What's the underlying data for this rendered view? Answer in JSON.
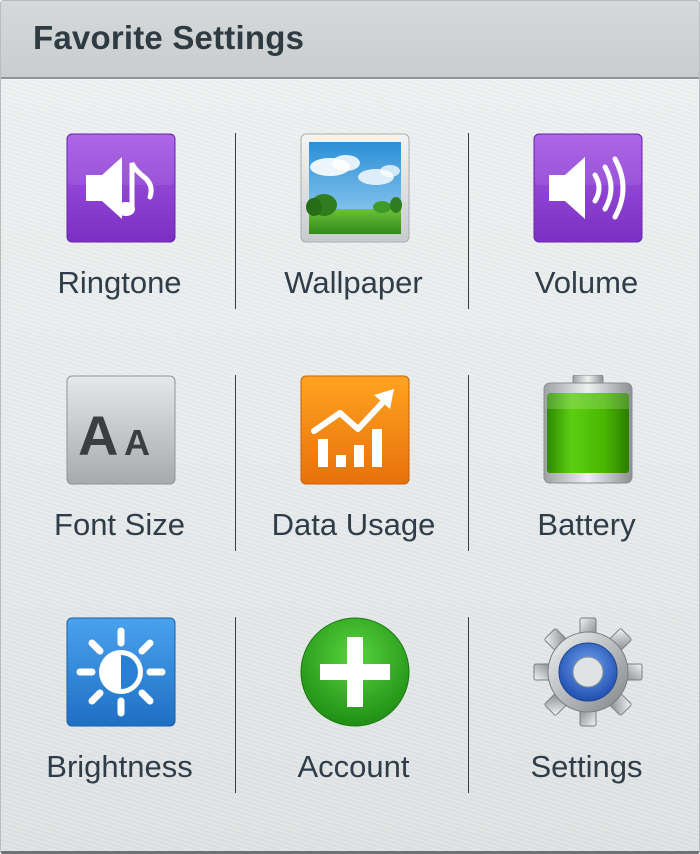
{
  "header": {
    "title": "Favorite Settings"
  },
  "items": [
    {
      "label": "Ringtone",
      "icon": "ringtone-icon"
    },
    {
      "label": "Wallpaper",
      "icon": "wallpaper-icon"
    },
    {
      "label": "Volume",
      "icon": "volume-icon"
    },
    {
      "label": "Font Size",
      "icon": "font-size-icon"
    },
    {
      "label": "Data Usage",
      "icon": "data-usage-icon"
    },
    {
      "label": "Battery",
      "icon": "battery-icon"
    },
    {
      "label": "Brightness",
      "icon": "brightness-icon"
    },
    {
      "label": "Account",
      "icon": "add-account-icon"
    },
    {
      "label": "Settings",
      "icon": "settings-gear-icon"
    }
  ],
  "colors": {
    "purple": "#8a3fd4",
    "orange": "#f07f10",
    "blue": "#2f86d9",
    "green": "#2fae1f",
    "battery_green": "#47b300"
  }
}
